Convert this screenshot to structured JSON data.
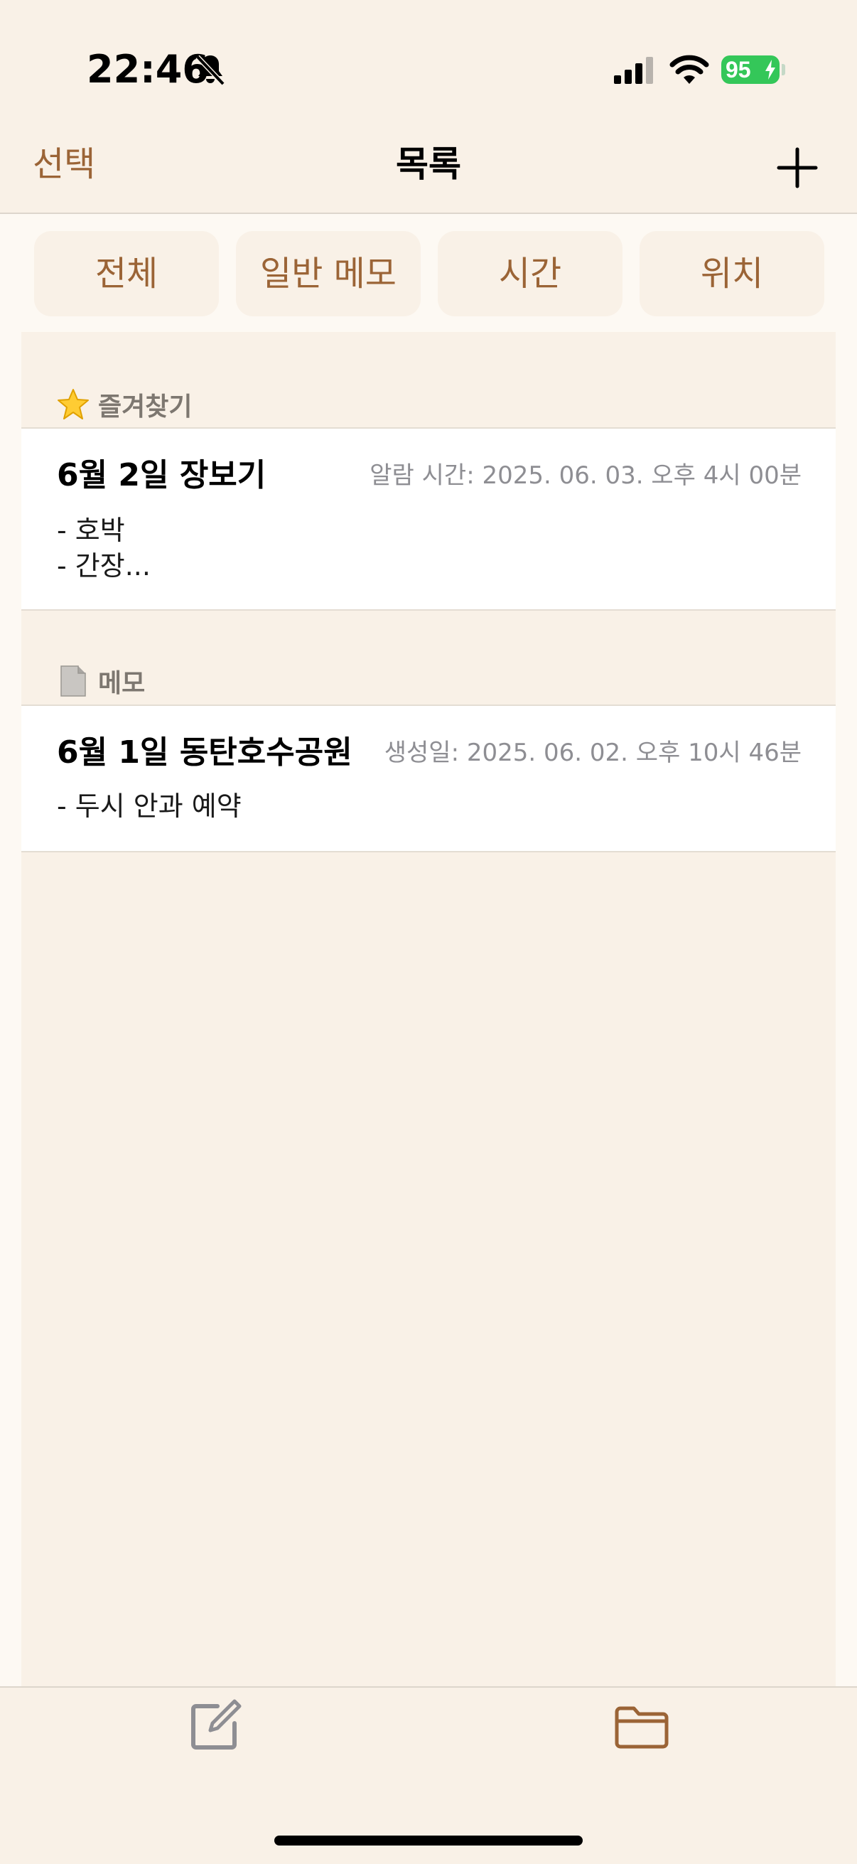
{
  "status_bar": {
    "time": "22:46",
    "battery": "95"
  },
  "nav": {
    "select_label": "선택",
    "title": "목록"
  },
  "filters": [
    {
      "label": "전체"
    },
    {
      "label": "일반 메모"
    },
    {
      "label": "시간"
    },
    {
      "label": "위치"
    }
  ],
  "sections": {
    "favorites": {
      "label": "즐겨찾기",
      "icon": "star-icon",
      "items": [
        {
          "title": "6월 2일 장보기",
          "meta": "알람 시간: 2025. 06. 03. 오후 4시 00분",
          "body": "- 호박\n- 간장..."
        }
      ]
    },
    "memos": {
      "label": "메모",
      "icon": "document-icon",
      "items": [
        {
          "title": "6월 1일 동탄호수공원",
          "meta": "생성일: 2025. 06. 02. 오후 10시 46분",
          "body": "- 두시 안과 예약"
        }
      ]
    }
  },
  "tabbar": {
    "items": [
      {
        "icon": "compose-icon",
        "active": false
      },
      {
        "icon": "folder-icon",
        "active": true
      }
    ]
  },
  "colors": {
    "accent": "#9b6436",
    "background": "#f9f1e7",
    "battery": "#34c759",
    "inactive_icon": "#8e8e93"
  }
}
